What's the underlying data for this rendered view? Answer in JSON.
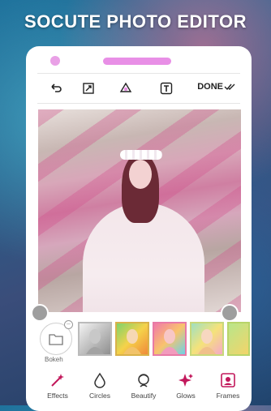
{
  "banner": {
    "title": "SOCUTE PHOTO EDITOR"
  },
  "toolbar": {
    "undo_icon": "undo-icon",
    "crop_icon": "crop-icon",
    "sticker_icon": "sticker-icon",
    "text_icon": "text-icon",
    "done_label": "DONE"
  },
  "bokeh": {
    "label": "Bokeh"
  },
  "thumbnails": [
    {
      "name": "grayscale"
    },
    {
      "name": "rainbow"
    },
    {
      "name": "pink-glow"
    },
    {
      "name": "pastel"
    },
    {
      "name": "more"
    }
  ],
  "nav": {
    "items": [
      {
        "label": "Effects",
        "icon": "magic-wand-icon"
      },
      {
        "label": "Circles",
        "icon": "drop-icon"
      },
      {
        "label": "Beautify",
        "icon": "face-icon"
      },
      {
        "label": "Glows",
        "icon": "sparkle-icon"
      },
      {
        "label": "Frames",
        "icon": "frame-icon"
      }
    ]
  },
  "colors": {
    "accent": "#e88fe6",
    "nav_label_active": "#c2185b"
  }
}
